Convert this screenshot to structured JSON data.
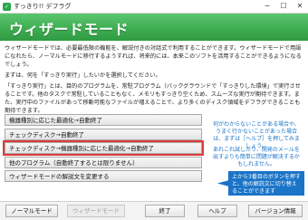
{
  "window": {
    "title": "すっきり!! デフラグ",
    "icon": "app-icon"
  },
  "header": {
    "title": "ウィザードモード",
    "color": "#3fae52"
  },
  "intro": {
    "p1": "ウィザードモードでは、必要最低限の機能を、解説付きの対話式で利用することができます。ウィザードモードで用語になれたら、ノーマルモードに移行するようすれば、将来的には、本来このソフトを活用することができるようになるでしょう。",
    "p2": "まずは、何を「すっきり実行」したいかを選択してください。",
    "p3": "「すっきり実行」とは、目的のプログラムを、常駐プログラム（バックグラウンドで「すっきりした環境」で実行させることです。他のタスクで常駐していることもなく、メモリもすっきり空くため、スムーズな実行が期待できます。また、実行中のファイルがあって移動可能なファイルが増えることで、より多くのディスク領域をデフラグできることも期待できます。"
  },
  "options": [
    {
      "label": "機器種別に応じた最適化→自動終了"
    },
    {
      "label": "チェックディスク→自動終了"
    },
    {
      "label": "チェックディスク→機器種別に応じた最適化→自動終了",
      "highlighted": true
    },
    {
      "label": "他のプログラム（自動終了するとは限りません）"
    },
    {
      "label": "ウィザードモードの解説文を変更する"
    }
  ],
  "notes": {
    "n1": "何がわからないことがある場合や、うまく行かないことがあった場合は、まずは［ヘルプ］を押してみましょう。",
    "n2": "あれこれ試したり、開発のメールを出すよりも簡単に問題が解決するかもしれません。",
    "arrow": "上から3番目のボタンを押すと、他の解説文に切り替えることができます"
  },
  "footer": {
    "normal_mode": "ノーマルモード",
    "wizard_mode": "ウィザードモード",
    "exit": "終了",
    "help": "ヘルプ",
    "version": "バージョン情報"
  },
  "colors": {
    "accent_blue": "#1a74c8",
    "highlight_red": "#e03a3a"
  }
}
